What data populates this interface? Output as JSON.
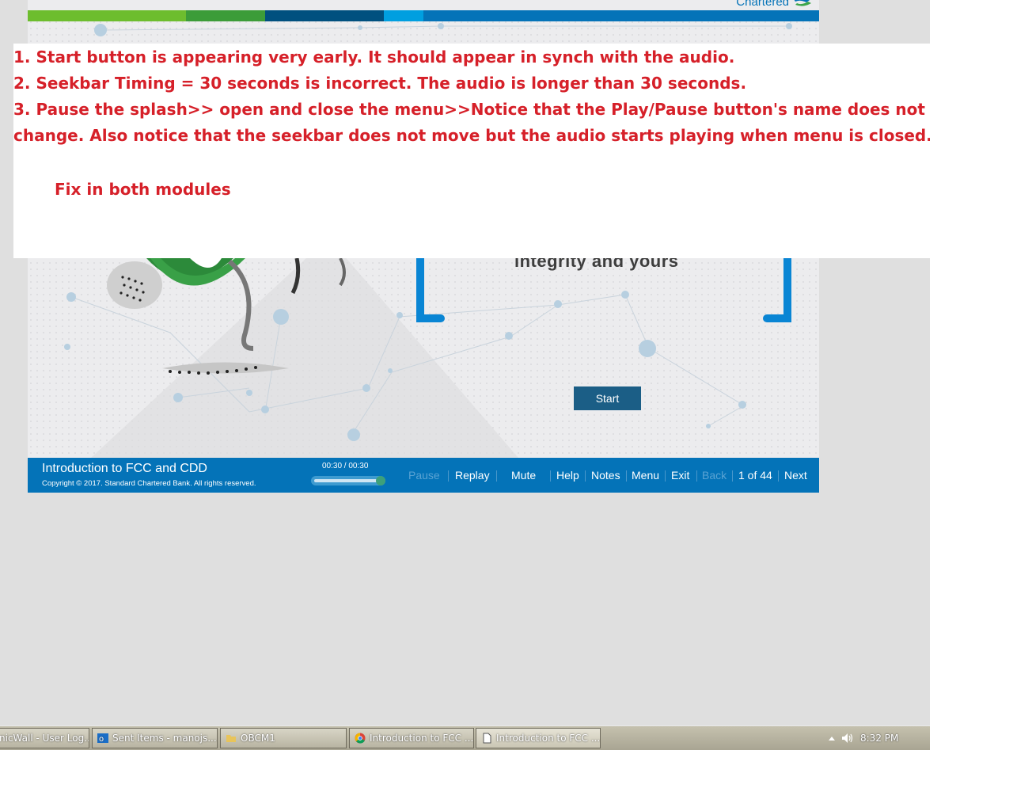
{
  "brand": {
    "name": "Chartered",
    "bar_colors": [
      "#6dbd2e",
      "#3c9c39",
      "#00507f",
      "#009fe0",
      "#0473b8"
    ]
  },
  "splash": {
    "text": "integrity and yours",
    "start_label": "Start"
  },
  "player": {
    "course_title": "Introduction to FCC and CDD",
    "copyright": "Copyright © 2017. Standard Chartered Bank. All rights reserved.",
    "seek_time": "00:30 / 00:30",
    "seek_progress": 1.0,
    "nav": {
      "pause": "Pause",
      "replay": "Replay",
      "mute": "Mute",
      "help": "Help",
      "notes": "Notes",
      "menu": "Menu",
      "exit": "Exit",
      "back": "Back",
      "page": "1 of 44",
      "next": "Next"
    }
  },
  "annotation": {
    "lines": [
      "1. Start button is appearing very early. It should appear in synch with the audio.",
      "2. Seekbar Timing  = 30 seconds is incorrect. The audio is longer than 30 seconds.",
      "3. Pause the splash>> open and close the menu>>Notice that the Play/Pause button's name does not",
      "change. Also notice that the seekbar does not move but the audio starts playing when menu is closed."
    ],
    "fix_note": "Fix in both modules",
    "color": "#d62029"
  },
  "taskbar": {
    "items": [
      {
        "label": "nicWall - User Log...",
        "icon": "browser-icon"
      },
      {
        "label": "Sent Items - manojs...",
        "icon": "outlook-icon"
      },
      {
        "label": "OBCM1",
        "icon": "folder-icon"
      },
      {
        "label": "Introduction to FCC ...",
        "icon": "chrome-icon"
      },
      {
        "label": "Introduction to FCC ...",
        "icon": "document-icon"
      }
    ],
    "clock": "8:32 PM",
    "tray_icons": [
      "show-hidden-icons-icon",
      "volume-icon"
    ]
  }
}
